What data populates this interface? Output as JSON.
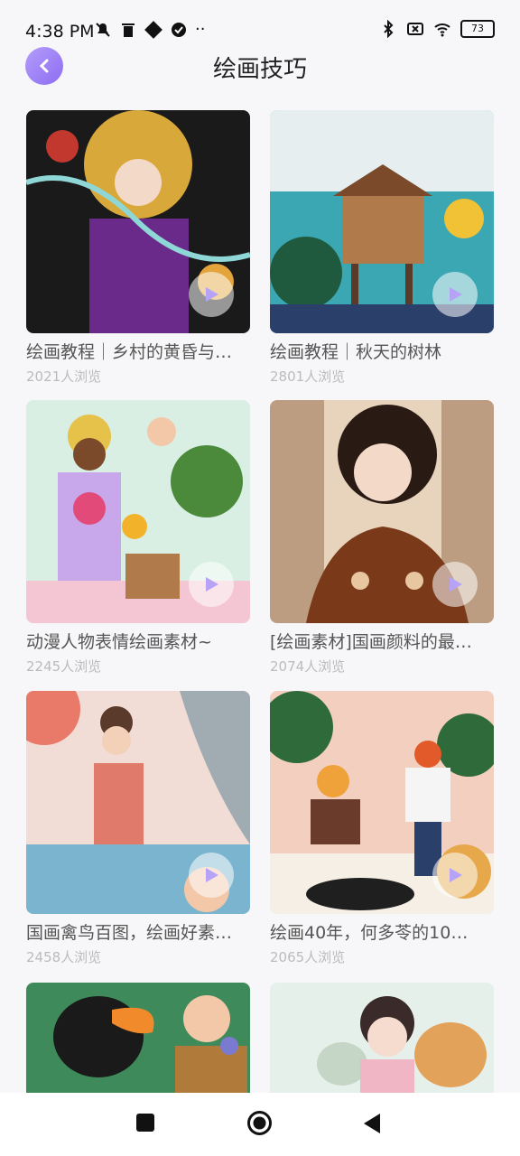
{
  "status_bar": {
    "time": "4:38 PM",
    "battery": "73"
  },
  "header": {
    "title": "绘画技巧"
  },
  "cards": [
    {
      "title": "绘画教程｜乡村的黄昏与…",
      "views": "2021人浏览"
    },
    {
      "title": "绘画教程｜秋天的树林",
      "views": "2801人浏览"
    },
    {
      "title": "动漫人物表情绘画素材~",
      "views": "2245人浏览"
    },
    {
      "title": "[绘画素材]国画颜料的最…",
      "views": "2074人浏览"
    },
    {
      "title": "国画禽鸟百图，绘画好素…",
      "views": "2458人浏览"
    },
    {
      "title": "绘画40年，何多苓的10…",
      "views": "2065人浏览"
    }
  ],
  "colors": {
    "accent": "#8e6cf2",
    "background": "#f7f7f9",
    "play_icon": "#b6a3f7"
  }
}
